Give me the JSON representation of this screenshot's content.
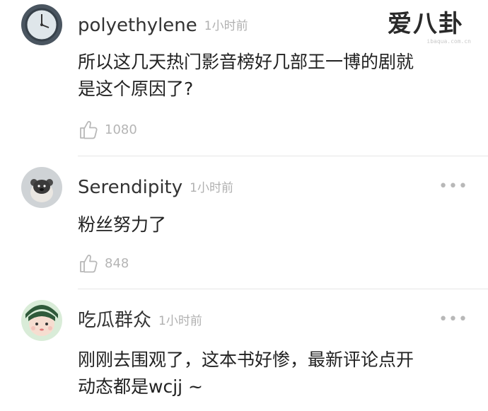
{
  "watermark": {
    "text": "爱八卦",
    "url": "ibaqua.com.cn"
  },
  "comments": [
    {
      "username": "polyethylene",
      "time": "1小时前",
      "text": "所以这几天热门影音榜好几部王一博的剧就\n是这个原因了?",
      "likes": "1080"
    },
    {
      "username": "Serendipity",
      "time": "1小时前",
      "text": "粉丝努力了",
      "likes": "848"
    },
    {
      "username": "吃瓜群众",
      "time": "1小时前",
      "text": "刚刚去围观了，这本书好惨，最新评论点开\n动态都是wcjj ~",
      "likes": ""
    }
  ]
}
